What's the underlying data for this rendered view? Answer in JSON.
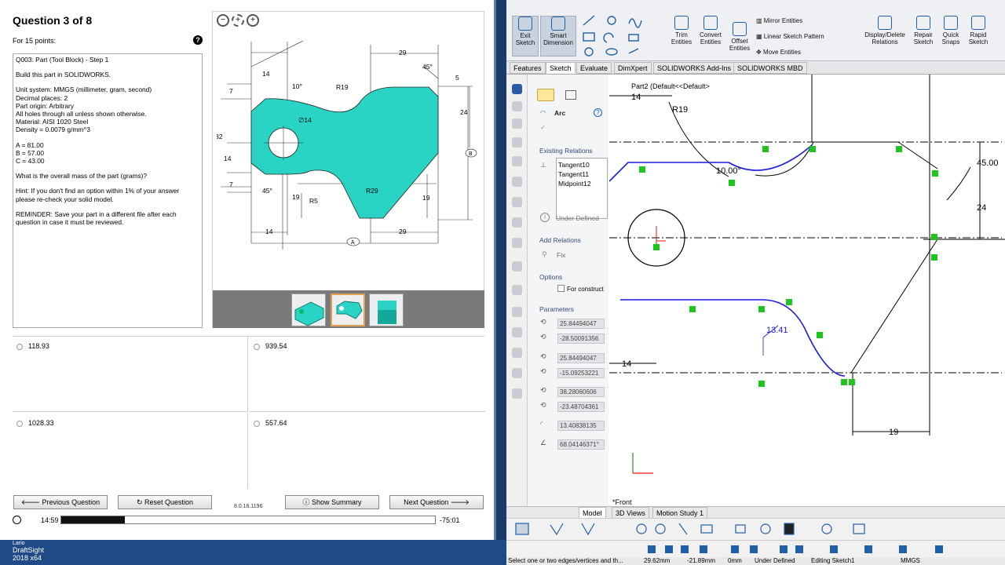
{
  "exam": {
    "title": "Question 3 of 8",
    "points": "For 15 points:",
    "help_icon": "?",
    "question_lines": [
      "Q003: Part (Tool Block) - Step 1",
      "Build this part in SOLIDWORKS.",
      "Unit system: MMGS (millimeter, gram, second)",
      "Decimal places: 2",
      "Part origin: Arbitrary",
      "All holes through all unless shown otherwise.",
      "Material: AISI 1020 Steel",
      "Density = 0.0079 g/mm^3",
      "A = 81.00",
      "B = 57.00",
      "C = 43.00",
      "What is the overall mass of the part (grams)?",
      "Hint: If you don't find an option within 1% of your answer",
      "please re-check your solid model.",
      "REMINDER: Save your part in a different file after each",
      "question in case it must be reviewed."
    ],
    "answers": [
      "118.93",
      "939.54",
      "1028.33",
      "557.64"
    ],
    "buttons": {
      "previous": "Previous Question",
      "reset": "Reset Question",
      "summary": "Show Summary",
      "next": "Next Question"
    },
    "version": "8.0.16.1196",
    "time_left": "14:59",
    "time_right": "-75:01",
    "progress_fraction": 0.17,
    "drawing": {
      "dims": [
        "14",
        "29",
        "45°",
        "5",
        "10°",
        "R19",
        "7",
        "∅14",
        "24",
        "32",
        "14",
        "7",
        "45°",
        "R5",
        "19",
        "R29",
        "19",
        "14",
        "29"
      ],
      "labels": [
        "A",
        "B"
      ]
    }
  },
  "desktop": {
    "label_line1": "DraftSight",
    "label_line2": "2018 x64",
    "label_line0": "Lario"
  },
  "solidworks": {
    "ribbon": {
      "exit_sketch": "Exit Sketch",
      "smart_dimension": "Smart Dimension",
      "trim": "Trim Entities",
      "convert": "Convert Entities",
      "offset": "Offset Entities",
      "mirror": "Mirror Entities",
      "linear_pattern": "Linear Sketch Pattern",
      "move": "Move Entities",
      "display_relations": "Display/Delete Relations",
      "repair": "Repair Sketch",
      "quick_snaps": "Quick Snaps",
      "rapid_sketch": "Rapid Sketch"
    },
    "tabs": [
      "Features",
      "Sketch",
      "Evaluate",
      "DimXpert",
      "SOLIDWORKS Add-Ins",
      "SOLIDWORKS MBD"
    ],
    "active_tab": "Sketch",
    "tree_title": "Part2  (Default<<Default>",
    "pm": {
      "title": "Arc",
      "existing_relations_header": "Existing Relations",
      "relations": [
        "Tangent10",
        "Tangent11",
        "Midpoint12"
      ],
      "under_defined": "Under Defined",
      "add_relations_header": "Add Relations",
      "fix": "Fix",
      "options_header": "Options",
      "for_construction": "For construct",
      "parameters_header": "Parameters",
      "params": [
        "25.84494047",
        "-28.50091356",
        "25.84494047",
        "-15.09253221",
        "38.28060606",
        "-23.48704361",
        "13.40838135",
        "68.04146371°"
      ]
    },
    "sketch_dims": [
      "14",
      "R19",
      "10.00°",
      "45.00",
      "24",
      "14",
      "13.41",
      "19"
    ],
    "view_label": "*Front",
    "bottom_tabs": [
      "Model",
      "3D Views",
      "Motion Study 1"
    ],
    "status": {
      "message": "Select one or two edges/vertices and th...",
      "x": "29.62mm",
      "y": "-21.89mm",
      "z": "0mm",
      "state": "Under Defined",
      "editing": "Editing Sketch1",
      "units": "MMGS"
    }
  },
  "colors": {
    "part_fill": "#2ad4c4",
    "sketch_blue": "#1a1ae0",
    "relation_green": "#1fc41f",
    "accent": "#1f5fa8"
  }
}
